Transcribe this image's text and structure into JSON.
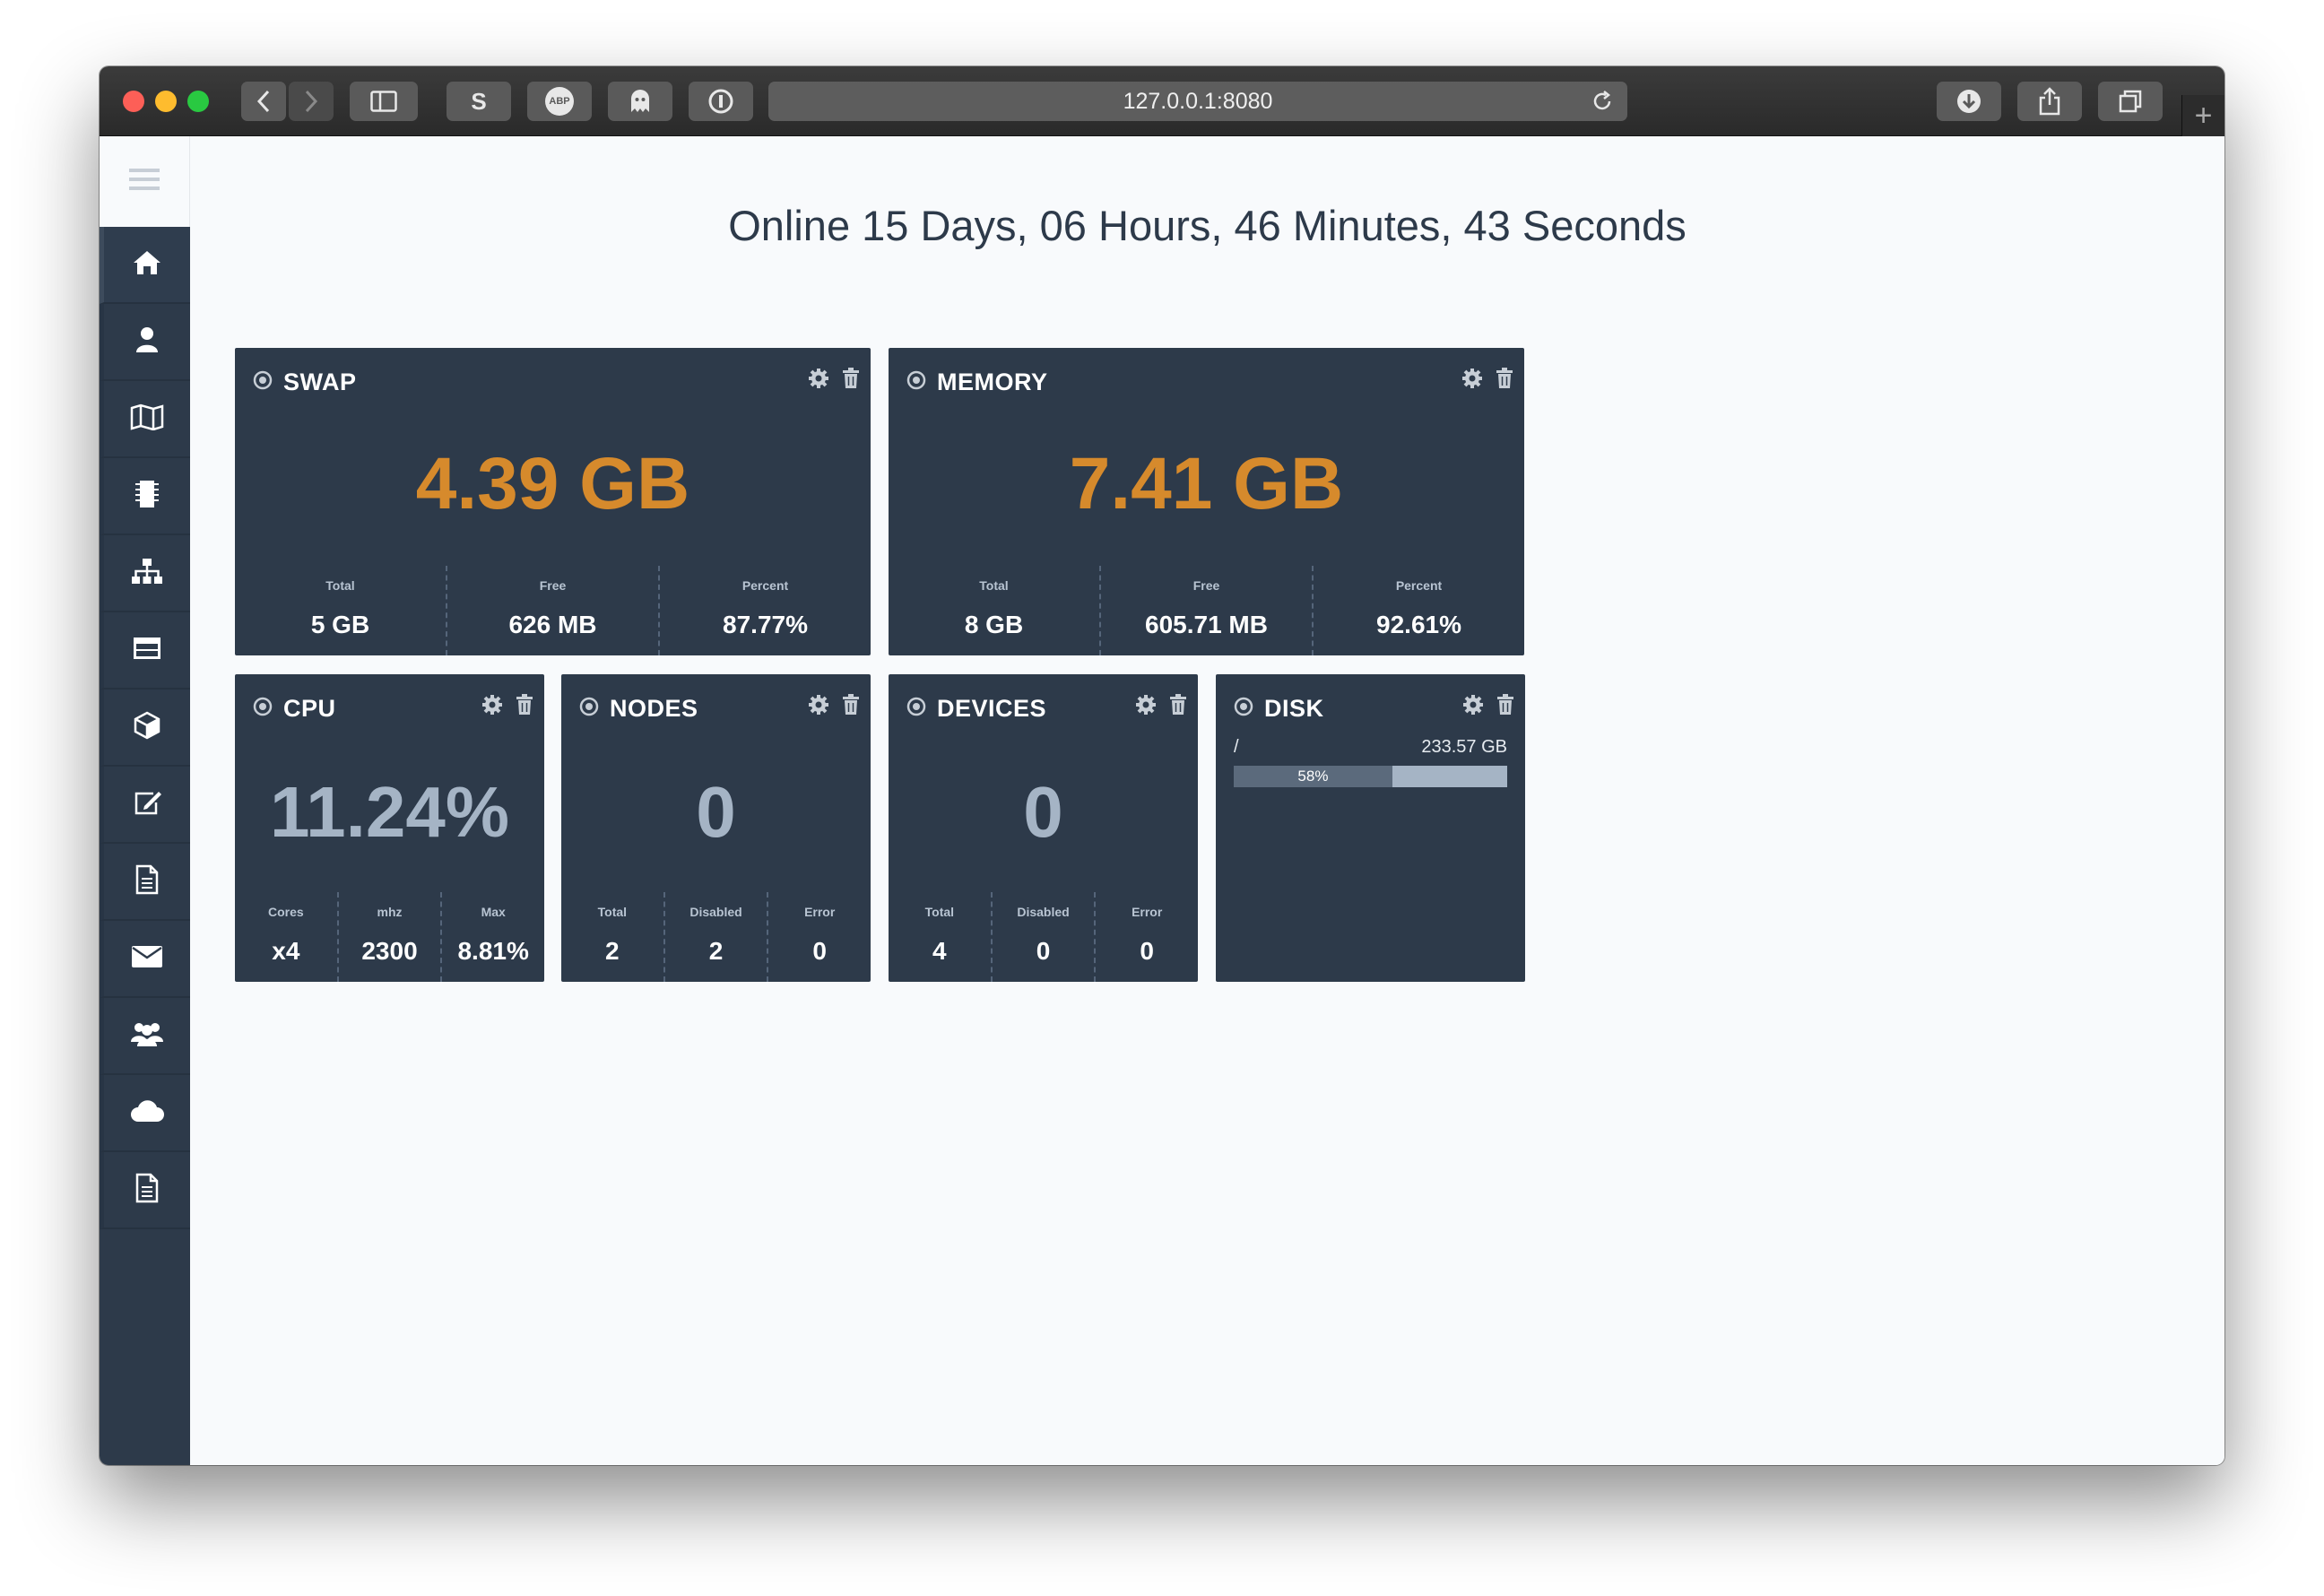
{
  "browser": {
    "url": "127.0.0.1:8080",
    "extension_s_label": "S",
    "extension_abp_label": "ABP"
  },
  "page": {
    "title": "Online 15 Days, 06 Hours, 46 Minutes, 43 Seconds"
  },
  "sidebar": {
    "items": [
      {
        "icon": "home-icon"
      },
      {
        "icon": "user-icon"
      },
      {
        "icon": "map-icon"
      },
      {
        "icon": "chip-icon"
      },
      {
        "icon": "sitemap-icon"
      },
      {
        "icon": "table-icon"
      },
      {
        "icon": "cube-icon"
      },
      {
        "icon": "edit-icon"
      },
      {
        "icon": "document-icon"
      },
      {
        "icon": "envelope-icon"
      },
      {
        "icon": "users-icon"
      },
      {
        "icon": "cloud-icon"
      },
      {
        "icon": "file-text-icon"
      }
    ]
  },
  "widgets": {
    "swap": {
      "title": "SWAP",
      "value": "4.39 GB",
      "stats": [
        {
          "label": "Total",
          "value": "5 GB"
        },
        {
          "label": "Free",
          "value": "626 MB"
        },
        {
          "label": "Percent",
          "value": "87.77%"
        }
      ]
    },
    "memory": {
      "title": "MEMORY",
      "value": "7.41 GB",
      "stats": [
        {
          "label": "Total",
          "value": "8 GB"
        },
        {
          "label": "Free",
          "value": "605.71 MB"
        },
        {
          "label": "Percent",
          "value": "92.61%"
        }
      ]
    },
    "cpu": {
      "title": "CPU",
      "value": "11.24%",
      "stats": [
        {
          "label": "Cores",
          "value": "x4"
        },
        {
          "label": "mhz",
          "value": "2300"
        },
        {
          "label": "Max",
          "value": "8.81%"
        }
      ]
    },
    "nodes": {
      "title": "NODES",
      "value": "0",
      "stats": [
        {
          "label": "Total",
          "value": "2"
        },
        {
          "label": "Disabled",
          "value": "2"
        },
        {
          "label": "Error",
          "value": "0"
        }
      ]
    },
    "devices": {
      "title": "DEVICES",
      "value": "0",
      "stats": [
        {
          "label": "Total",
          "value": "4"
        },
        {
          "label": "Disabled",
          "value": "0"
        },
        {
          "label": "Error",
          "value": "0"
        }
      ]
    },
    "disk": {
      "title": "DISK",
      "mount": "/",
      "size": "233.57 GB",
      "used_percent_label": "58%",
      "used_fraction": 0.58
    }
  },
  "colors": {
    "accent_orange": "#d68a2c",
    "card_bg": "#2d3a4a",
    "value_grey": "#a5b4c5"
  }
}
